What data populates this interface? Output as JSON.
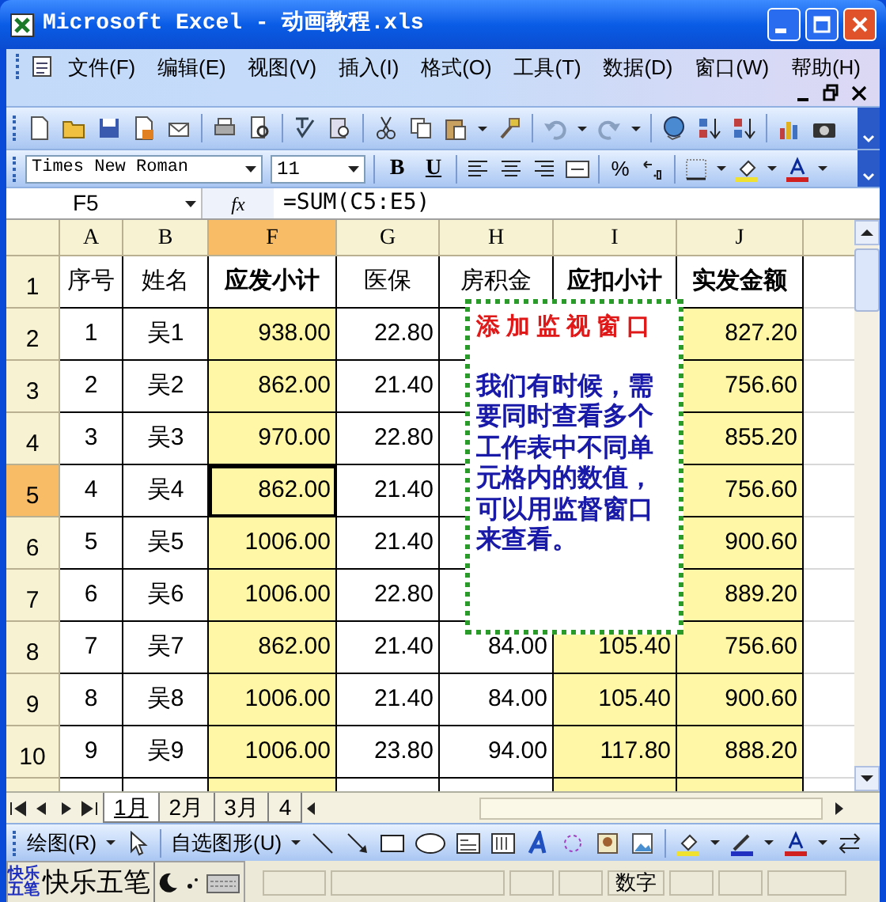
{
  "window": {
    "title": "Microsoft Excel - 动画教程.xls"
  },
  "menu": [
    {
      "label": "文件(F)"
    },
    {
      "label": "编辑(E)"
    },
    {
      "label": "视图(V)"
    },
    {
      "label": "插入(I)"
    },
    {
      "label": "格式(O)"
    },
    {
      "label": "工具(T)"
    },
    {
      "label": "数据(D)"
    },
    {
      "label": "窗口(W)"
    },
    {
      "label": "帮助(H)"
    }
  ],
  "format_toolbar": {
    "font": "Times New Roman",
    "size": "11",
    "bold_button": "B",
    "underline_button": "U",
    "percent_button": "%"
  },
  "formula_bar": {
    "name_box": "F5",
    "fx": "fx",
    "formula": "=SUM(C5:E5)"
  },
  "sheet": {
    "columns": [
      {
        "label": "A",
        "selected": false
      },
      {
        "label": "B",
        "selected": false
      },
      {
        "label": "F",
        "selected": true
      },
      {
        "label": "G",
        "selected": false
      },
      {
        "label": "H",
        "selected": false
      },
      {
        "label": "I",
        "selected": false
      },
      {
        "label": "J",
        "selected": false
      }
    ],
    "rows": [
      {
        "header": "1",
        "selected": false,
        "cells": [
          {
            "text": "序号",
            "bold": false,
            "shaded": false,
            "selected": false
          },
          {
            "text": "姓名",
            "bold": false,
            "shaded": false,
            "selected": false
          },
          {
            "text": "应发小计",
            "bold": true,
            "shaded": false,
            "selected": false
          },
          {
            "text": "医保",
            "bold": false,
            "shaded": false,
            "selected": false
          },
          {
            "text": "房积金",
            "bold": false,
            "shaded": false,
            "selected": false
          },
          {
            "text": "应扣小计",
            "bold": true,
            "shaded": false,
            "selected": false
          },
          {
            "text": "实发金额",
            "bold": true,
            "shaded": false,
            "selected": false
          }
        ]
      },
      {
        "header": "2",
        "selected": false,
        "cells": [
          {
            "text": "1",
            "shaded": false,
            "selected": false
          },
          {
            "text": "吴1",
            "shaded": false,
            "selected": false
          },
          {
            "text": "938.00",
            "shaded": true,
            "selected": false
          },
          {
            "text": "22.80",
            "shaded": false,
            "selected": false
          },
          null,
          null,
          {
            "text": "827.20",
            "shaded": true,
            "selected": false
          }
        ]
      },
      {
        "header": "3",
        "selected": false,
        "cells": [
          {
            "text": "2",
            "shaded": false,
            "selected": false
          },
          {
            "text": "吴2",
            "shaded": false,
            "selected": false
          },
          {
            "text": "862.00",
            "shaded": true,
            "selected": false
          },
          {
            "text": "21.40",
            "shaded": false,
            "selected": false
          },
          null,
          null,
          {
            "text": "756.60",
            "shaded": true,
            "selected": false
          }
        ]
      },
      {
        "header": "4",
        "selected": false,
        "cells": [
          {
            "text": "3",
            "shaded": false,
            "selected": false
          },
          {
            "text": "吴3",
            "shaded": false,
            "selected": false
          },
          {
            "text": "970.00",
            "shaded": true,
            "selected": false
          },
          {
            "text": "22.80",
            "shaded": false,
            "selected": false
          },
          null,
          null,
          {
            "text": "855.20",
            "shaded": true,
            "selected": false
          }
        ]
      },
      {
        "header": "5",
        "selected": true,
        "cells": [
          {
            "text": "4",
            "shaded": false,
            "selected": false
          },
          {
            "text": "吴4",
            "shaded": false,
            "selected": false
          },
          {
            "text": "862.00",
            "shaded": true,
            "selected": true
          },
          {
            "text": "21.40",
            "shaded": false,
            "selected": false
          },
          null,
          null,
          {
            "text": "756.60",
            "shaded": true,
            "selected": false
          }
        ]
      },
      {
        "header": "6",
        "selected": false,
        "cells": [
          {
            "text": "5",
            "shaded": false,
            "selected": false
          },
          {
            "text": "吴5",
            "shaded": false,
            "selected": false
          },
          {
            "text": "1006.00",
            "shaded": true,
            "selected": false
          },
          {
            "text": "21.40",
            "shaded": false,
            "selected": false
          },
          null,
          null,
          {
            "text": "900.60",
            "shaded": true,
            "selected": false
          }
        ]
      },
      {
        "header": "7",
        "selected": false,
        "cells": [
          {
            "text": "6",
            "shaded": false,
            "selected": false
          },
          {
            "text": "吴6",
            "shaded": false,
            "selected": false
          },
          {
            "text": "1006.00",
            "shaded": true,
            "selected": false
          },
          {
            "text": "22.80",
            "shaded": false,
            "selected": false
          },
          null,
          null,
          {
            "text": "889.20",
            "shaded": true,
            "selected": false
          }
        ]
      },
      {
        "header": "8",
        "selected": false,
        "cells": [
          {
            "text": "7",
            "shaded": false,
            "selected": false
          },
          {
            "text": "吴7",
            "shaded": false,
            "selected": false
          },
          {
            "text": "862.00",
            "shaded": true,
            "selected": false
          },
          {
            "text": "21.40",
            "shaded": false,
            "selected": false
          },
          {
            "text": "84.00",
            "shaded": false,
            "selected": false
          },
          {
            "text": "105.40",
            "shaded": true,
            "selected": false
          },
          {
            "text": "756.60",
            "shaded": true,
            "selected": false
          }
        ]
      },
      {
        "header": "9",
        "selected": false,
        "cells": [
          {
            "text": "8",
            "shaded": false,
            "selected": false
          },
          {
            "text": "吴8",
            "shaded": false,
            "selected": false
          },
          {
            "text": "1006.00",
            "shaded": true,
            "selected": false
          },
          {
            "text": "21.40",
            "shaded": false,
            "selected": false
          },
          {
            "text": "84.00",
            "shaded": false,
            "selected": false
          },
          {
            "text": "105.40",
            "shaded": true,
            "selected": false
          },
          {
            "text": "900.60",
            "shaded": true,
            "selected": false
          }
        ]
      },
      {
        "header": "10",
        "selected": false,
        "cells": [
          {
            "text": "9",
            "shaded": false,
            "selected": false
          },
          {
            "text": "吴9",
            "shaded": false,
            "selected": false
          },
          {
            "text": "1006.00",
            "shaded": true,
            "selected": false
          },
          {
            "text": "23.80",
            "shaded": false,
            "selected": false
          },
          {
            "text": "94.00",
            "shaded": false,
            "selected": false
          },
          {
            "text": "117.80",
            "shaded": true,
            "selected": false
          },
          {
            "text": "888.20",
            "shaded": true,
            "selected": false
          }
        ]
      }
    ]
  },
  "callout": {
    "title": "添加监视窗口",
    "body": "我们有时候，需要同时查看多个工作表中不同单元格内的数值，可以用监督窗口来查看。"
  },
  "sheet_tabs": [
    {
      "label": "1月",
      "selected": true
    },
    {
      "label": "2月",
      "selected": false
    },
    {
      "label": "3月",
      "selected": false
    },
    {
      "label": "4",
      "selected": false
    }
  ],
  "drawing_toolbar": {
    "draw_menu": "绘图(R)",
    "autoshapes_menu": "自选图形(U)"
  },
  "status_bar": {
    "ime_logo": "快乐五笔",
    "ime_name": "快乐五笔",
    "mode": "数字"
  }
}
